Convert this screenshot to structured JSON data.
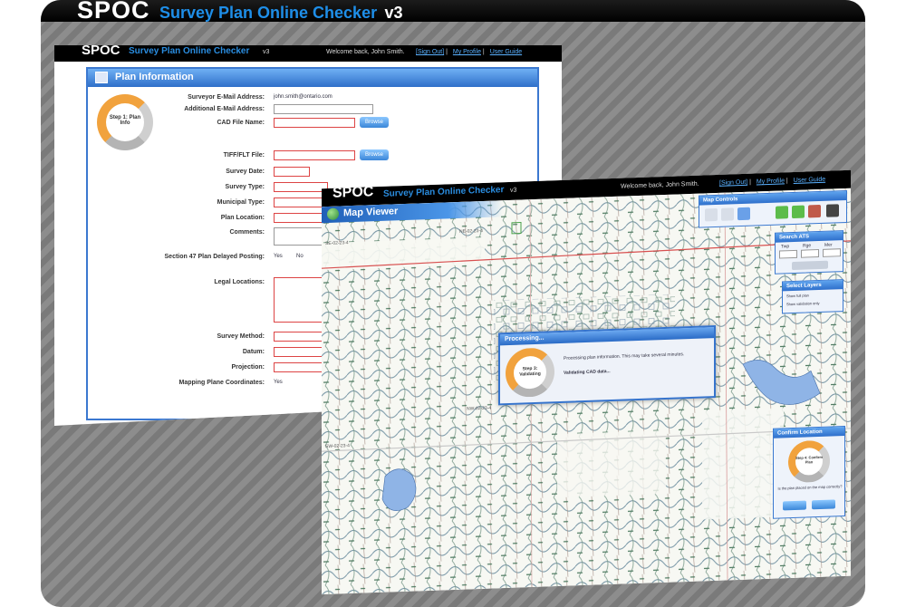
{
  "banner": {
    "logo": "SPOC",
    "subtitle": "Survey Plan Online Checker",
    "version": "v3"
  },
  "back_window": {
    "logo": "SPOC",
    "subtitle": "Survey Plan Online Checker",
    "version": "v3",
    "welcome": "Welcome back, John Smith.",
    "nav": [
      "[Sign Out]",
      "My Profile",
      "User Guide"
    ],
    "panel_title": "Plan Information",
    "step": "Step 1: Plan Info",
    "fields": {
      "surveyor_email_label": "Surveyor E-Mail Address:",
      "surveyor_email_value": "john.smith@ontario.com",
      "additional_email_label": "Additional E-Mail Address:",
      "cad_label": "CAD File Name:",
      "tiff_label": "TIFF/FLT File:",
      "survey_date_label": "Survey Date:",
      "survey_type_label": "Survey Type:",
      "municipal_type_label": "Municipal Type:",
      "plan_location_label": "Plan Location:",
      "comments_label": "Comments:",
      "section47_label": "Section 47 Plan Delayed Posting:",
      "yes_option": "Yes",
      "no_option": "No",
      "legal_locations_label": "Legal Locations:",
      "survey_method_label": "Survey Method:",
      "datum_label": "Datum:",
      "projection_label": "Projection:",
      "mapping_plane_label": "Mapping Plane Coordinates:"
    },
    "browse_label": "Browse"
  },
  "front_window": {
    "logo": "SPOC",
    "subtitle": "Survey Plan Online Checker",
    "version": "v3",
    "welcome": "Welcome back, John Smith.",
    "nav": [
      "[Sign Out]",
      "My Profile",
      "User Guide"
    ],
    "panel_title": "Map Viewer",
    "map_controls": "Map Controls",
    "search_ats": "Search ATS",
    "search_cols": [
      "Twp",
      "Rge",
      "Mer"
    ],
    "select_layers": "Select Layers",
    "layer_options": [
      "Show full plan",
      "Show validation only"
    ],
    "processing": {
      "title": "Processing...",
      "step": "Step 3: Validating",
      "message": "Processing plan information. This may take several minutes.",
      "status": "Validating CAD data..."
    },
    "confirm": {
      "title": "Confirm Location",
      "step": "Step 4: Confirm Plan",
      "question": "Is the plan placed on the map correctly?"
    },
    "map_labels": [
      "NE-02-23-4",
      "SE-02-23-4",
      "SW-02-23-4",
      "NW-02-23-4"
    ]
  }
}
